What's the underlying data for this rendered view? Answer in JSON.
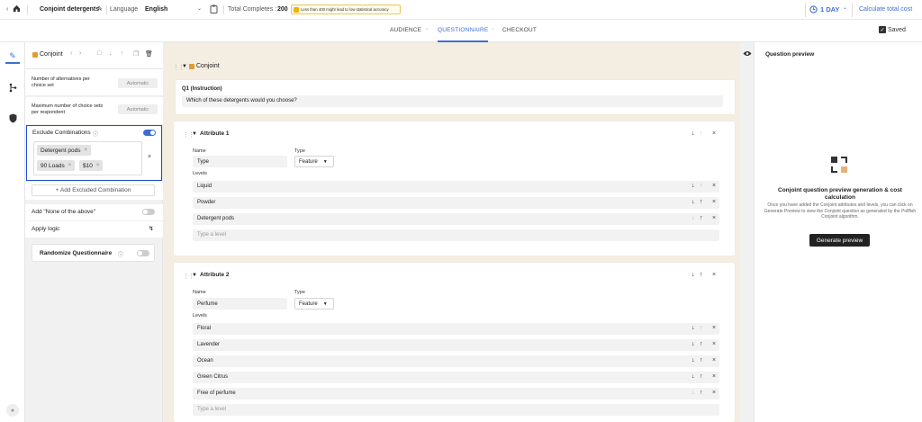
{
  "topbar": {
    "back_icon": "chevron-left",
    "home_icon": "home",
    "survey_title": "Conjoint detergents",
    "edit_icon": "pencil",
    "language_label": "Language",
    "language_value": "English",
    "clipboard_icon": "clipboard",
    "total_completes_label": "Total Completes :",
    "total_completes_value": "200",
    "warning_text": "Less than 400 might lead to low statistical accuracy",
    "duration_label": "1 DAY",
    "calculate_label": "Calculate total cost"
  },
  "tabs": [
    {
      "label": "AUDIENCE"
    },
    {
      "label": "QUESTIONNAIRE"
    },
    {
      "label": "CHECKOUT"
    }
  ],
  "saved_label": "Saved",
  "left_panel": {
    "block_label": "Conjoint",
    "alternatives_label": "Number of alternatives per choice set",
    "alternatives_value": "Automatic",
    "max_sets_label": "Maximum number of choice sets per respondent",
    "max_sets_value": "Automatic",
    "exclude_label": "Exclude Combinations",
    "exclude_on": true,
    "chips": [
      "Detergent pods",
      "90 Loads",
      "$10"
    ],
    "add_excluded": "+ Add Excluded Combination",
    "none_of_above": "Add \"None of the above\"",
    "apply_logic": "Apply logic",
    "randomize": "Randomize Questionnaire"
  },
  "center": {
    "block_title": "Conjoint",
    "q1": {
      "label": "Q1 (Instruction)",
      "text": "Which of these detergents would you choose?"
    },
    "attributes": [
      {
        "title": "Attribute 1",
        "name_label": "Name",
        "name_value": "Type",
        "type_label": "Type",
        "type_value": "Feature",
        "levels_label": "Levels",
        "levels": [
          "Liquid",
          "Powder",
          "Detergent pods"
        ],
        "placeholder": "Type a level"
      },
      {
        "title": "Attribute 2",
        "name_label": "Name",
        "name_value": "Perfume",
        "type_label": "Type",
        "type_value": "Feature",
        "levels_label": "Levels",
        "levels": [
          "Floral",
          "Lavender",
          "Ocean",
          "Green Citrus",
          "Free of perfume"
        ],
        "placeholder": "Type a level"
      }
    ]
  },
  "preview": {
    "title": "Question preview",
    "heading": "Conjoint question preview generation & cost calculation",
    "body": "Once you have added the Conjoint attributes and levels, you can click on Generate Preview to view the Conjoint question as generated by the Pollfish Conjoint algorithm.",
    "button": "Generate preview"
  },
  "colors": {
    "accent": "#3b6fd6",
    "block_bg": "#f4ede2",
    "highlight": "#1f4fd6"
  }
}
